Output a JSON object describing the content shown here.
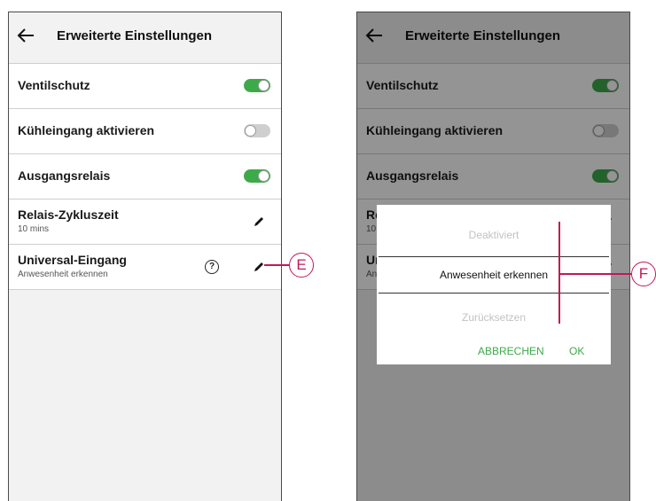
{
  "left_screen": {
    "back_icon": "arrow-left-icon",
    "title": "Erweiterte Einstellungen",
    "rows": [
      {
        "label": "Ventilschutz",
        "toggle": "on"
      },
      {
        "label": "Kühleingang aktivieren",
        "toggle": "off"
      },
      {
        "label": "Ausgangsrelais",
        "toggle": "on"
      },
      {
        "label": "Relais-Zykluszeit",
        "sub": "10 mins"
      },
      {
        "label": "Universal-Eingang",
        "sub": "Anwesenheit erkennen",
        "help": "?"
      }
    ],
    "callout": "E"
  },
  "right_screen": {
    "back_icon": "arrow-left-icon",
    "title": "Erweiterte Einstellungen",
    "rows": [
      {
        "label": "Ventilschutz",
        "toggle": "on"
      },
      {
        "label": "Kühleingang aktivieren",
        "toggle": "off"
      },
      {
        "label": "Ausgangsrelais",
        "toggle": "on"
      },
      {
        "label": "Re",
        "sub": "10"
      },
      {
        "label": "Un",
        "sub": "An"
      }
    ],
    "dialog": {
      "options": [
        "Deaktiviert",
        "Anwesenheit erkennen",
        "Zurücksetzen"
      ],
      "selected_index": 1,
      "cancel_label": "ABBRECHEN",
      "ok_label": "OK"
    },
    "callout": "F"
  },
  "colors": {
    "toggle_on": "#3daa4a",
    "toggle_off": "#cfcfcf",
    "accent_text": "#3daa4a",
    "callout": "#c2185b"
  }
}
